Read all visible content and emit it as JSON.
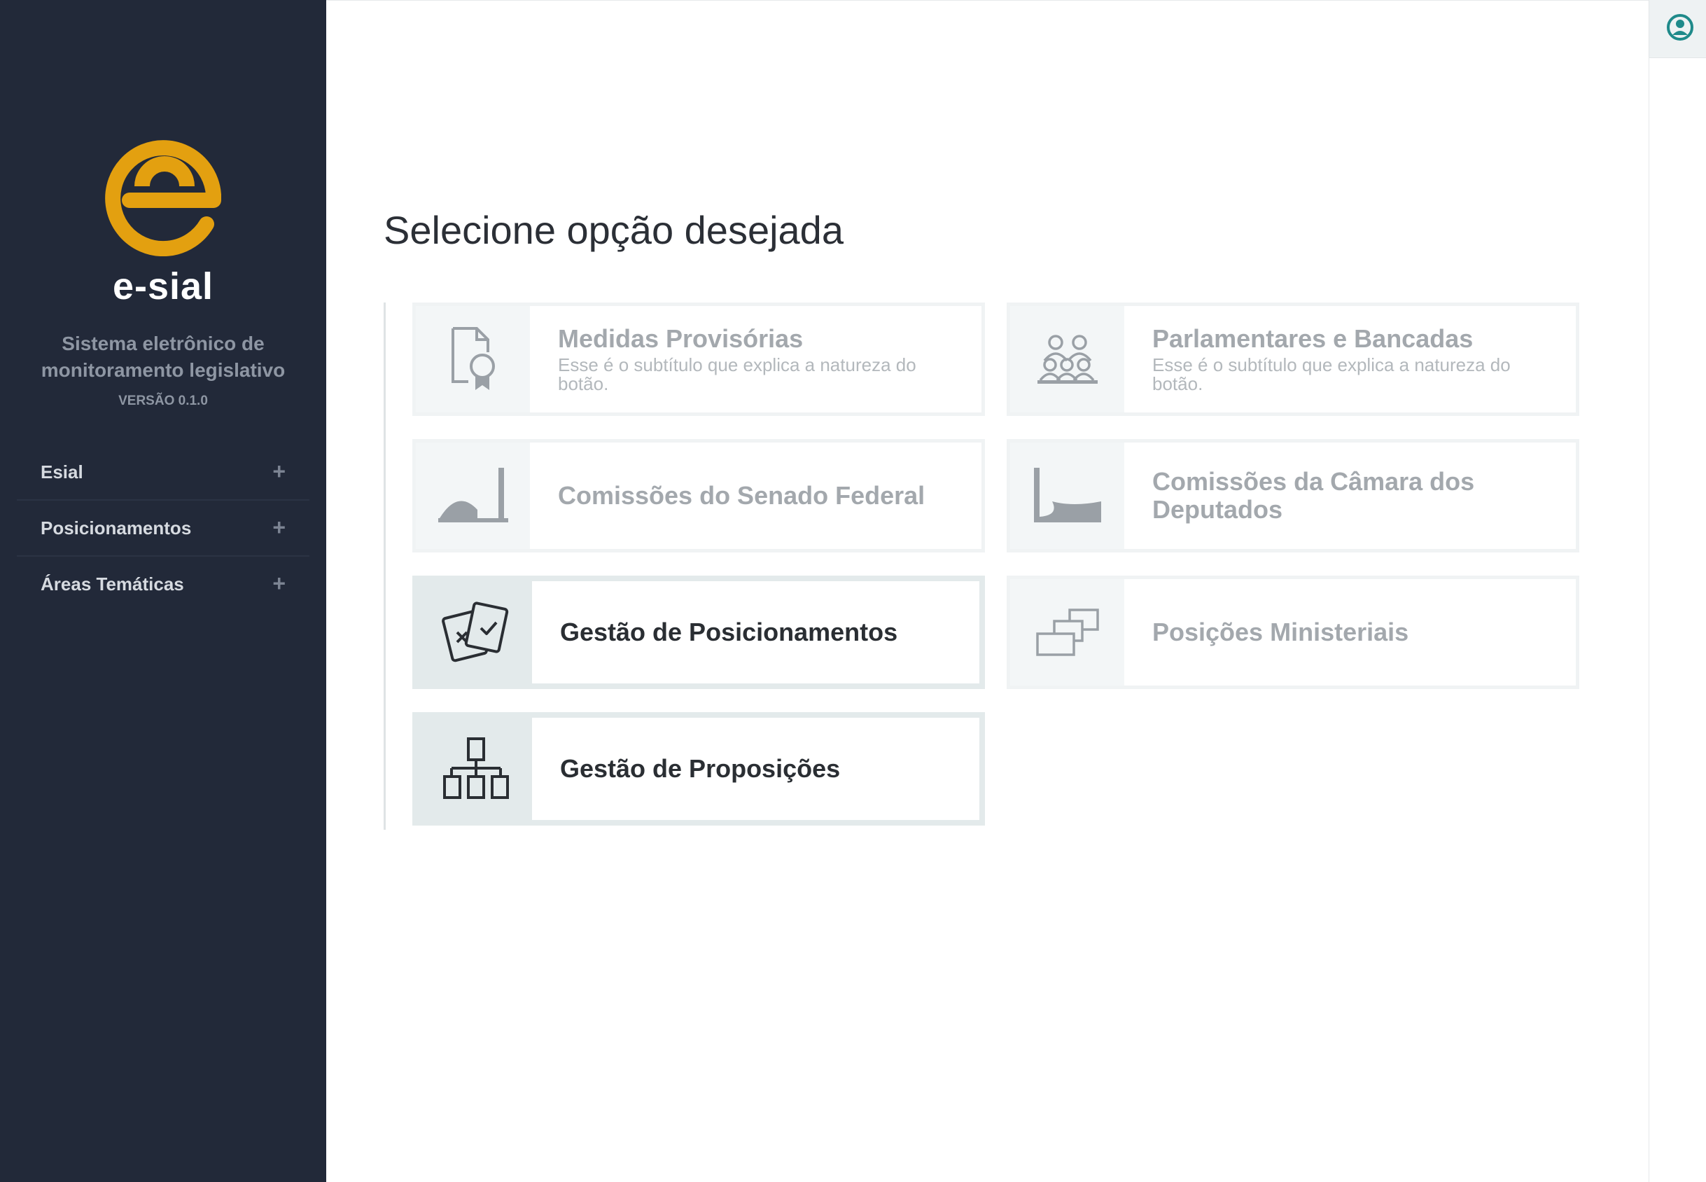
{
  "app": {
    "name": "e-sial",
    "tagline": "Sistema eletrônico de monitoramento legislativo",
    "version": "VERSÃO 0.1.0"
  },
  "sidebar": {
    "items": [
      {
        "label": "Esial",
        "expand": "+"
      },
      {
        "label": "Posicionamentos",
        "expand": "+"
      },
      {
        "label": "Áreas Temáticas",
        "expand": "+"
      }
    ]
  },
  "header": {
    "user_icon": "user-circle-icon"
  },
  "main": {
    "title": "Selecione opção desejada",
    "cards": [
      {
        "title": "Medidas Provisórias",
        "subtitle": "Esse é o subtítulo que explica a natureza do botão.",
        "icon": "document-certificate-icon",
        "active": false
      },
      {
        "title": "Parlamentares e Bancadas",
        "subtitle": "Esse é o subtítulo que explica a natureza do botão.",
        "icon": "people-group-icon",
        "active": false
      },
      {
        "title": "Comissões do Senado Federal",
        "subtitle": "",
        "icon": "senate-dome-icon",
        "active": false
      },
      {
        "title": "Comissões da Câmara dos Deputados",
        "subtitle": "",
        "icon": "chamber-bowl-icon",
        "active": false
      },
      {
        "title": "Gestão de Posicionamentos",
        "subtitle": "",
        "icon": "vote-cards-icon",
        "active": true
      },
      {
        "title": "Posições Ministeriais",
        "subtitle": "",
        "icon": "stacked-windows-icon",
        "active": false
      },
      {
        "title": "Gestão de Proposições",
        "subtitle": "",
        "icon": "hierarchy-icon",
        "active": true
      }
    ]
  },
  "colors": {
    "sidebar_bg": "#222939",
    "logo_orange": "#E3A010",
    "muted_text": "#a3a8ad",
    "active_text": "#2a2e33"
  }
}
